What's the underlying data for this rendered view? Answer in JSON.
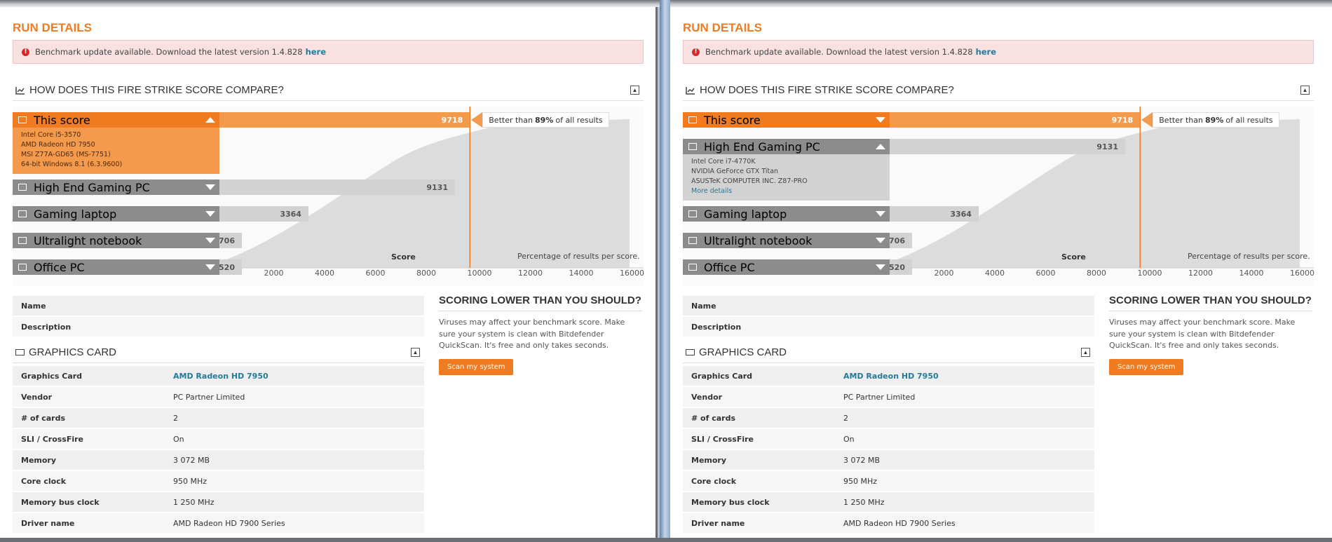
{
  "panels": [
    {
      "id": "left",
      "run_title": "RUN DETAILS",
      "alert": {
        "text": "Benchmark update available. Download the latest version 1.4.828",
        "link": "here"
      },
      "compare_title": "HOW DOES THIS FIRE STRIKE SCORE COMPARE?",
      "rows": [
        {
          "label": "This score",
          "value": "9718",
          "expanded": true,
          "details": [
            "Intel Core i5-3570",
            "AMD Radeon HD 7950",
            "MSI Z77A-GD65 (MS-7751)",
            "64-bit Windows 8.1 (6.3.9600)"
          ]
        },
        {
          "label": "High End Gaming PC",
          "value": "9131",
          "expanded": false
        },
        {
          "label": "Gaming laptop",
          "value": "3364",
          "expanded": false
        },
        {
          "label": "Ultralight notebook",
          "value": "706",
          "expanded": false
        },
        {
          "label": "Office PC",
          "value": "520",
          "expanded": false
        }
      ],
      "better": {
        "prefix": "Better than",
        "pct": "89%",
        "suffix": "of all results"
      },
      "axis_ticks": [
        "2000",
        "4000",
        "6000",
        "8000",
        "10000",
        "12000",
        "14000",
        "16000"
      ],
      "score_label": "Score",
      "pct_label": "Percentage of results per score.",
      "name_rows": [
        {
          "key": "Name",
          "val": ""
        },
        {
          "key": "Description",
          "val": ""
        }
      ],
      "graphics_title": "GRAPHICS CARD",
      "graphics_rows": [
        {
          "key": "Graphics Card",
          "val": "AMD Radeon HD 7950"
        },
        {
          "key": "Vendor",
          "val": "PC Partner Limited"
        },
        {
          "key": "# of cards",
          "val": "2"
        },
        {
          "key": "SLI / CrossFire",
          "val": "On"
        },
        {
          "key": "Memory",
          "val": "3 072 MB"
        },
        {
          "key": "Core clock",
          "val": "950 MHz"
        },
        {
          "key": "Memory bus clock",
          "val": "1 250 MHz"
        },
        {
          "key": "Driver name",
          "val": "AMD Radeon HD 7900 Series"
        }
      ],
      "side": {
        "title": "SCORING LOWER THAN YOU SHOULD?",
        "text": "Viruses may affect your benchmark score. Make sure your system is clean with Bitdefender QuickScan. It's free and only takes seconds.",
        "button": "Scan my system"
      }
    },
    {
      "id": "right",
      "run_title": "RUN DETAILS",
      "alert": {
        "text": "Benchmark update available. Download the latest version 1.4.828",
        "link": "here"
      },
      "compare_title": "HOW DOES THIS FIRE STRIKE SCORE COMPARE?",
      "rows": [
        {
          "label": "This score",
          "value": "9718",
          "expanded": false
        },
        {
          "label": "High End Gaming PC",
          "value": "9131",
          "expanded": true,
          "details": [
            "Intel Core i7-4770K",
            "NVIDIA GeForce GTX Titan",
            "ASUSTeK COMPUTER INC. Z87-PRO"
          ],
          "more": "More details"
        },
        {
          "label": "Gaming laptop",
          "value": "3364",
          "expanded": false
        },
        {
          "label": "Ultralight notebook",
          "value": "706",
          "expanded": false
        },
        {
          "label": "Office PC",
          "value": "520",
          "expanded": false
        }
      ],
      "better": {
        "prefix": "Better than",
        "pct": "89%",
        "suffix": "of all results"
      },
      "axis_ticks": [
        "2000",
        "4000",
        "6000",
        "8000",
        "10000",
        "12000",
        "14000",
        "16000"
      ],
      "score_label": "Score",
      "pct_label": "Percentage of results per score.",
      "name_rows": [
        {
          "key": "Name",
          "val": ""
        },
        {
          "key": "Description",
          "val": ""
        }
      ],
      "graphics_title": "GRAPHICS CARD",
      "graphics_rows": [
        {
          "key": "Graphics Card",
          "val": "AMD Radeon HD 7950"
        },
        {
          "key": "Vendor",
          "val": "PC Partner Limited"
        },
        {
          "key": "# of cards",
          "val": "2"
        },
        {
          "key": "SLI / CrossFire",
          "val": "On"
        },
        {
          "key": "Memory",
          "val": "3 072 MB"
        },
        {
          "key": "Core clock",
          "val": "950 MHz"
        },
        {
          "key": "Memory bus clock",
          "val": "1 250 MHz"
        },
        {
          "key": "Driver name",
          "val": "AMD Radeon HD 7900 Series"
        }
      ],
      "side": {
        "title": "SCORING LOWER THAN YOU SHOULD?",
        "text": "Viruses may affect your benchmark score. Make sure your system is clean with Bitdefender QuickScan. It's free and only takes seconds.",
        "button": "Scan my system"
      }
    }
  ],
  "colors": {
    "accent": "#f07b20",
    "accent_light": "#f39a4c",
    "gray_bar": "#8c8c8c",
    "link": "#237a9b"
  }
}
